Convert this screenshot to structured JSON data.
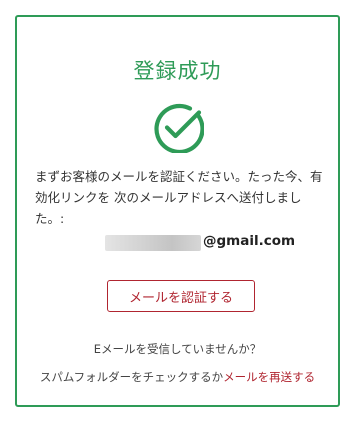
{
  "card": {
    "title": "登録成功",
    "check_icon": "check-circle-icon",
    "message": "まずお客様のメールを認証ください。たった今、有効化リンクを 次のメールアドレスへ送付しました。:",
    "email_domain": "@gmail.com",
    "verify_button_label": "メールを認証する",
    "not_received_text": "Eメールを受信していませんか？",
    "spam_text": "スパムフォルダーをチェックするか",
    "resend_link": "メールを再送する"
  },
  "colors": {
    "accent_green": "#2e9b57",
    "accent_red": "#b02530",
    "text": "#333333"
  }
}
